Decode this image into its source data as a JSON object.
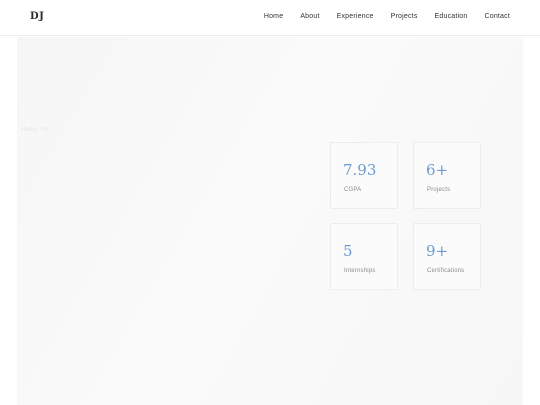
{
  "nav": {
    "logo": "DJ",
    "links": [
      "Home",
      "About",
      "Experience",
      "Projects",
      "Education",
      "Contact"
    ]
  },
  "hero": {
    "greeting": "Hello, I'm"
  },
  "stats": [
    {
      "value": "7.93",
      "label": "CGPA"
    },
    {
      "value": "6+",
      "label": "Projects"
    },
    {
      "value": "5",
      "label": "Internships"
    },
    {
      "value": "9+",
      "label": "Certifications"
    }
  ],
  "colors": {
    "accent": "#6b9bd1",
    "text": "#333333",
    "muted": "#8a8a8a"
  }
}
